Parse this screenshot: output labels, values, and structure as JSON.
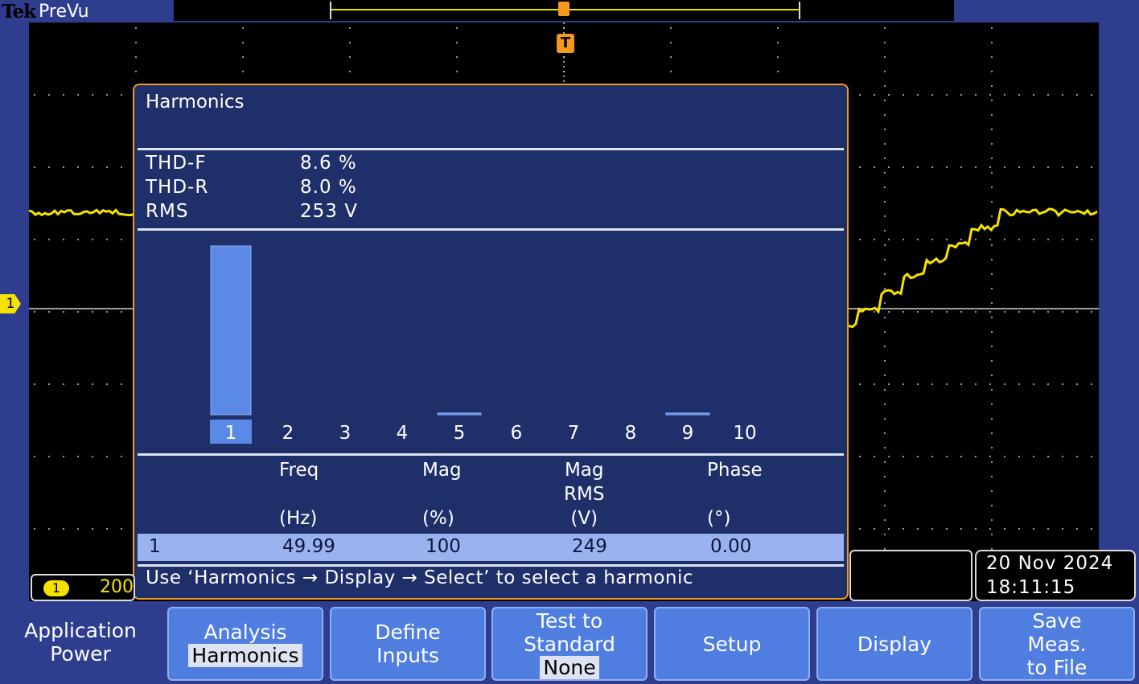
{
  "topbar": {
    "brand": "Tek",
    "mode": "PreVu"
  },
  "panel": {
    "title": "Harmonics",
    "stats": [
      {
        "label": "THD-F",
        "value": "8.6 %"
      },
      {
        "label": "THD-R",
        "value": "8.0 %"
      },
      {
        "label": "RMS",
        "value": "253 V"
      }
    ],
    "columns": {
      "freq": {
        "name": "Freq",
        "unit": "(Hz)"
      },
      "mag": {
        "name": "Mag",
        "unit": "(%)"
      },
      "magrms": {
        "name": "Mag\nRMS",
        "unit": "(V)"
      },
      "phase": {
        "name": "Phase",
        "unit": "(°)"
      }
    },
    "selected": {
      "harmonic": "1",
      "freq": "49.99",
      "mag": "100",
      "magrms": "249",
      "phase": "0.00"
    },
    "hint": "Use ‘Harmonics → Display → Select’ to select a harmonic"
  },
  "chart_data": {
    "type": "bar",
    "categories": [
      "1",
      "2",
      "3",
      "4",
      "5",
      "6",
      "7",
      "8",
      "9",
      "10"
    ],
    "values": [
      100,
      0,
      0,
      0,
      1,
      0,
      0,
      0,
      1,
      0
    ],
    "selected_index": 0,
    "bar_color": "#5b8ae6",
    "ylim": [
      0,
      100
    ]
  },
  "channel": {
    "number": "1",
    "scale": "200"
  },
  "datetime": {
    "date": "20 Nov 2024",
    "time": "18:11:15"
  },
  "markers": {
    "trigger": "T",
    "level": "1"
  },
  "menu": {
    "app": {
      "line1": "Application",
      "line2": "Power"
    },
    "buttons": [
      {
        "id": "analysis",
        "line1": "Analysis",
        "line2": "Harmonics"
      },
      {
        "id": "define-inputs",
        "line1": "Define",
        "line2": "Inputs"
      },
      {
        "id": "test-to-standard",
        "line1": "Test to",
        "line2": "Standard",
        "line3": "None"
      },
      {
        "id": "setup",
        "line1": "Setup"
      },
      {
        "id": "display",
        "line1": "Display"
      },
      {
        "id": "save",
        "line1": "Save",
        "line2": "Meas.",
        "line3": "to File"
      }
    ]
  },
  "colors": {
    "trace": "#f5e200",
    "accent": "#f39a1e",
    "background": "#2f3d8f",
    "highlight": "#99b3ee"
  }
}
